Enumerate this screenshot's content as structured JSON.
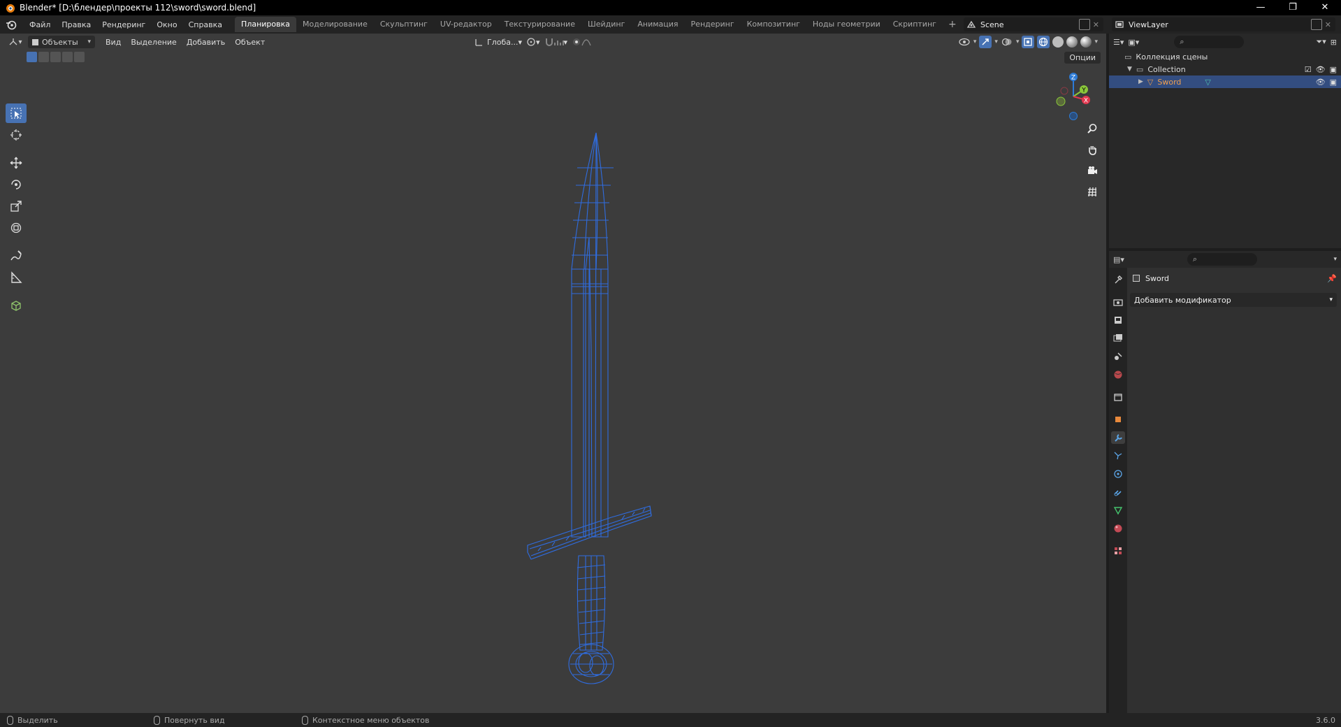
{
  "window": {
    "title": "Blender* [D:\\блендер\\проекты 112\\sword\\sword.blend]",
    "controls": [
      "—",
      "❐",
      "✕"
    ]
  },
  "menubar": {
    "menus": [
      "Файл",
      "Правка",
      "Рендеринг",
      "Окно",
      "Справка"
    ],
    "workspaces": [
      "Планировка",
      "Моделирование",
      "Скульптинг",
      "UV-редактор",
      "Текстурирование",
      "Шейдинг",
      "Анимация",
      "Рендеринг",
      "Композитинг",
      "Ноды геометрии",
      "Скриптинг"
    ],
    "active_workspace": "Планировка",
    "add_workspace": "+",
    "scene": "Scene",
    "view_layer": "ViewLayer"
  },
  "viewport": {
    "mode": "Объекты",
    "menus": [
      "Вид",
      "Выделение",
      "Добавить",
      "Объект"
    ],
    "orientation": "Глоба...",
    "options": "Опции",
    "accent": "#4772b3",
    "wire_color": "#2f6fe8",
    "gizmo_labels": {
      "z": "Z",
      "y": "Y",
      "x": "X"
    }
  },
  "outliner": {
    "scene_collection": "Коллекция сцены",
    "collection": "Collection",
    "object": "Sword"
  },
  "properties": {
    "object_name": "Sword",
    "add_modifier": "Добавить модификатор"
  },
  "statusbar": {
    "items": [
      "Выделить",
      "Повернуть вид",
      "Контекстное меню объектов"
    ],
    "version": "3.6.0"
  }
}
